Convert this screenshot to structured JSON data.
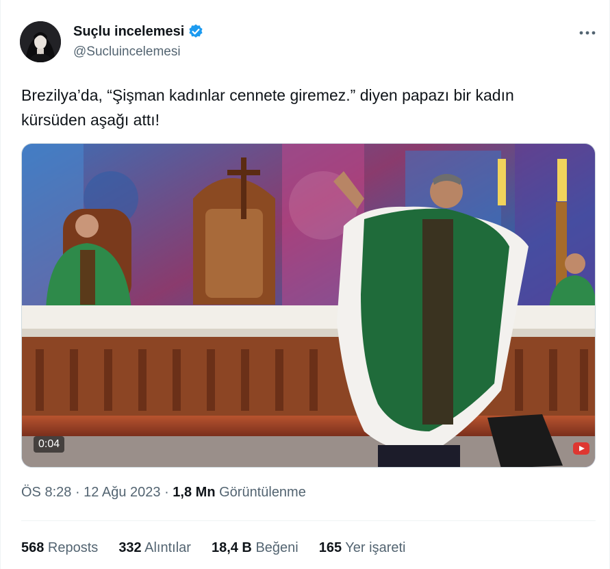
{
  "author": {
    "display_name": "Suçlu incelemesi",
    "handle": "@Sucluincelemesi",
    "verified_icon": "verified-badge-icon",
    "avatar_icon": "avatar"
  },
  "more_icon": "more-options-icon",
  "tweet": {
    "text_line1": "Brezilya’da, “Şişman kadınlar cennete giremez.” diyen papazı bir kadın",
    "text_line2": "kürsüden aşağı attı!"
  },
  "media": {
    "timestamp": "0:04",
    "badge_icon": "youtube-logo-icon"
  },
  "meta": {
    "time": "ÖS 8:28",
    "sep1": " · ",
    "date": "12 Ağu 2023",
    "sep2": " · ",
    "views_count": "1,8 Mn",
    "views_label": " Görüntülenme"
  },
  "stats": {
    "reposts_count": "568",
    "reposts_label": " Reposts",
    "quotes_count": "332",
    "quotes_label": " Alıntılar",
    "likes_count": "18,4 B",
    "likes_label": " Beğeni",
    "bookmarks_count": "165",
    "bookmarks_label": " Yer işareti"
  },
  "colors": {
    "verified_blue": "#1d9bf0",
    "text_primary": "#0f1419",
    "text_secondary": "#536471",
    "divider": "#eff3f4"
  }
}
